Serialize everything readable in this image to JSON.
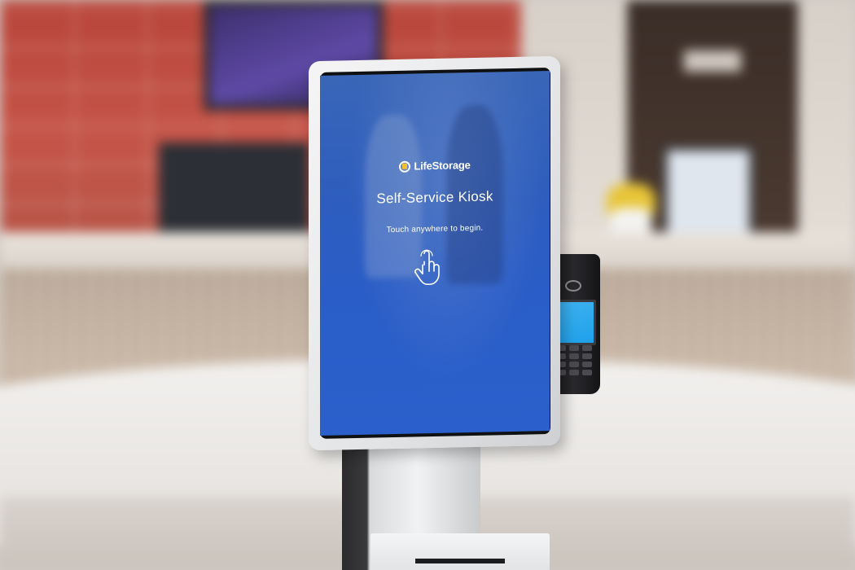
{
  "kiosk": {
    "brand": "LifeStorage",
    "title": "Self-Service Kiosk",
    "subtitle": "Touch anywhere to begin.",
    "touch_icon": "hand-tap-icon",
    "screen_color": "#2b5ec6",
    "brand_accent": "#f2c22e"
  },
  "terminal": {
    "screen_color": "#1ea0ea",
    "contactless_icon": "contactless-icon"
  }
}
